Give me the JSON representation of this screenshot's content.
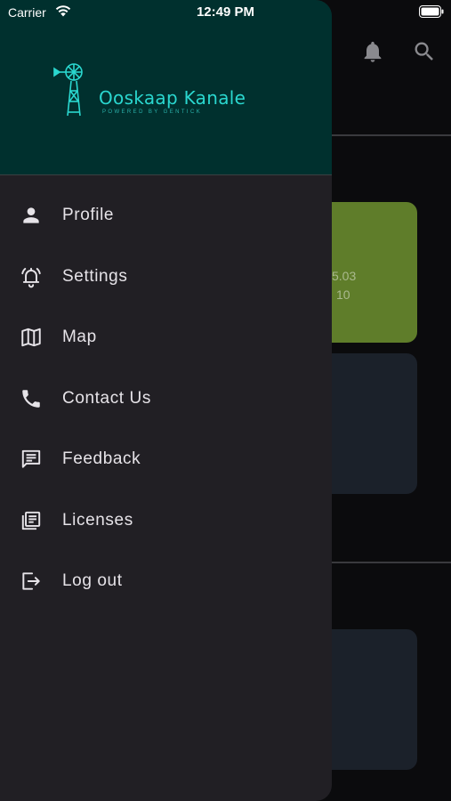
{
  "status_bar": {
    "carrier": "Carrier",
    "time": "12:49 PM"
  },
  "drawer": {
    "logo": {
      "title": "Ooskaap Kanale",
      "subtitle": "POWERED BY GENTICK"
    },
    "menu": [
      {
        "label": "Profile",
        "icon": "person-icon"
      },
      {
        "label": "Settings",
        "icon": "alarm-bell-icon"
      },
      {
        "label": "Map",
        "icon": "map-icon"
      },
      {
        "label": "Contact Us",
        "icon": "phone-icon"
      },
      {
        "label": "Feedback",
        "icon": "message-icon"
      },
      {
        "label": "Licenses",
        "icon": "library-books-icon"
      },
      {
        "label": "Log out",
        "icon": "logout-icon"
      }
    ]
  },
  "background": {
    "card_values": [
      "5.03",
      "10"
    ]
  },
  "colors": {
    "drawer_bg": "#211f24",
    "header_bg": "#00302e",
    "accent": "#2ad7cf",
    "green_card": "#5f7d2a",
    "dark_card": "#1b212a"
  }
}
